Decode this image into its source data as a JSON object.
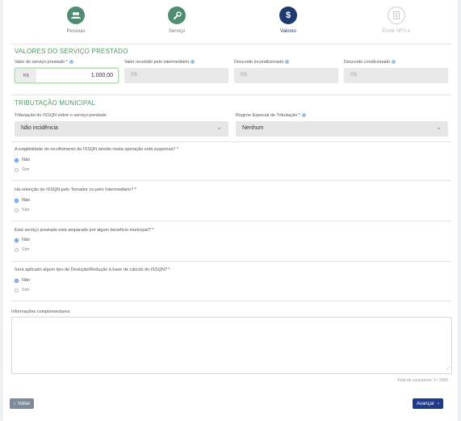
{
  "stepper": {
    "steps": [
      {
        "label": "Pessoas",
        "icon": "people-icon",
        "state": "done"
      },
      {
        "label": "Serviço",
        "icon": "wrench-icon",
        "state": "done"
      },
      {
        "label": "Valores",
        "icon": "dollar-icon",
        "state": "active"
      },
      {
        "label": "Emitir NFS-e",
        "icon": "document-icon",
        "state": "todo"
      }
    ]
  },
  "valores": {
    "title": "VALORES DO SERVIÇO PRESTADO",
    "valor_servico": {
      "label": "Valor do serviço prestado *",
      "currency": "R$",
      "value": "1.000,00"
    },
    "valor_intermediario": {
      "label": "Valor recebido pelo intermediário",
      "currency": "R$"
    },
    "desconto_incondicionado": {
      "label": "Desconto incondicionado",
      "currency": "R$"
    },
    "desconto_condicionado": {
      "label": "Desconto condicionado",
      "currency": "R$"
    }
  },
  "tributacao": {
    "title": "TRIBUTAÇÃO MUNICIPAL",
    "issqn_label": "Tributação do ISSQN sobre o serviço prestado",
    "issqn_value": "Não incidência",
    "regime_label": "Regime Especial de Tributação *",
    "regime_value": "Nenhum"
  },
  "questions": [
    {
      "text": "A exigibilidade do recolhimento do ISSQN devido nesta operação está suspensa? *",
      "options": [
        "Não",
        "Sim"
      ],
      "selected": "Não"
    },
    {
      "text": "Há retenção do ISSQN pelo Tomador ou pelo Intermediário? *",
      "options": [
        "Não",
        "Sim"
      ],
      "selected": "Não"
    },
    {
      "text": "Este serviço prestado está amparado por algum benefício municipal? *",
      "options": [
        "Não",
        "Sim"
      ],
      "selected": "Não"
    },
    {
      "text": "Será aplicado algum tipo de Dedução/Redução à base de cálculo do ISSQN? *",
      "options": [
        "Não",
        "Sim"
      ],
      "selected": "Não"
    }
  ],
  "informacoes": {
    "label": "Informações complementares",
    "value": "",
    "counter": "Total de caracteres: 0 / 2000"
  },
  "actions": {
    "back_label": "Voltar",
    "next_label": "Avançar"
  },
  "colors": {
    "accent_green": "#4e9a5f",
    "step_done": "#4e8d6f",
    "step_active": "#1f3a6d",
    "primary_button": "#1f3a8a",
    "secondary_button": "#7e8a99"
  }
}
